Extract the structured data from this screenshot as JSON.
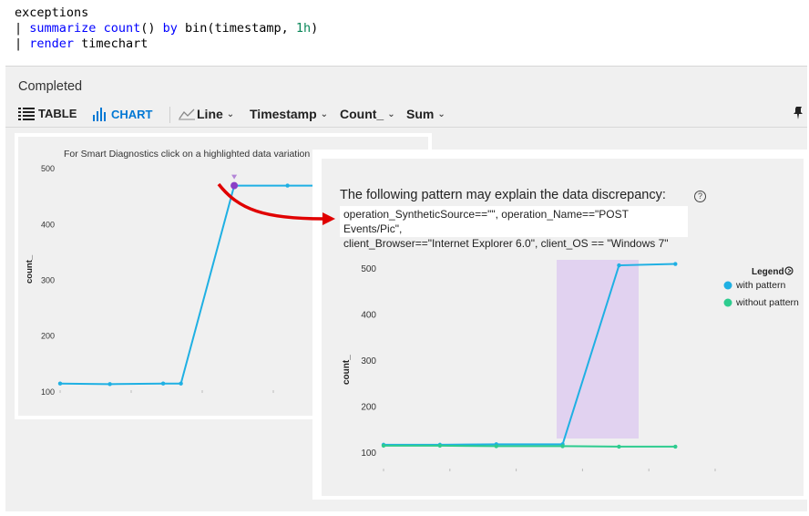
{
  "query": {
    "line1": "exceptions",
    "line2_pipe": "| ",
    "line2_kw1": "summarize",
    "line2_kw2": "count",
    "line2_mid1": "() ",
    "line2_kw3": "by",
    "line2_mid2": " bin(timestamp, ",
    "line2_num": "1h",
    "line2_end": ")",
    "line3_pipe": "| ",
    "line3_kw": "render",
    "line3_end": " timechart"
  },
  "status": "Completed",
  "toolbar": {
    "table_label": "TABLE",
    "chart_label": "CHART",
    "line_label": "Line",
    "timestamp_label": "Timestamp",
    "count_label": "Count_",
    "sum_label": "Sum"
  },
  "left_chart": {
    "hint": "For Smart Diagnostics click on a highlighted data variation",
    "ylabel": "count_",
    "yticks": [
      "500",
      "400",
      "300",
      "200",
      "100"
    ]
  },
  "right_panel": {
    "title": "The following pattern may explain the data discrepancy:",
    "pattern_line1": "operation_SyntheticSource==\"\", operation_Name==\"POST Events/Pic\",",
    "pattern_line2": "client_Browser==\"Internet Explorer 6.0\", client_OS == \"Windows 7\"",
    "ylabel": "count_",
    "yticks": [
      "500",
      "400",
      "300",
      "200",
      "100"
    ],
    "legend_title": "Legend",
    "legend_items": [
      "with pattern",
      "without pattern"
    ]
  },
  "colors": {
    "accent": "#0078d4",
    "with_pattern": "#1fb0e3",
    "without_pattern": "#2ecc8f",
    "highlight": "#e1d2f0",
    "selected_point": "#8a3fc7",
    "arrow": "#e00000"
  },
  "chart_data": [
    {
      "type": "line",
      "ylabel": "count_",
      "ylim": [
        90,
        520
      ],
      "x": [
        0,
        1,
        2,
        3,
        4,
        5,
        6,
        7
      ],
      "series": [
        {
          "values": [
            115,
            114,
            115,
            115,
            470,
            470,
            470,
            470
          ]
        }
      ]
    },
    {
      "type": "line",
      "ylabel": "count_",
      "ylim": [
        90,
        520
      ],
      "x": [
        0,
        1,
        2,
        3,
        4,
        5
      ],
      "series": [
        {
          "name": "with pattern",
          "values": [
            118,
            118,
            119,
            119,
            508,
            511
          ]
        },
        {
          "name": "without pattern",
          "values": [
            116,
            116,
            115,
            115,
            114,
            114
          ]
        }
      ]
    }
  ]
}
